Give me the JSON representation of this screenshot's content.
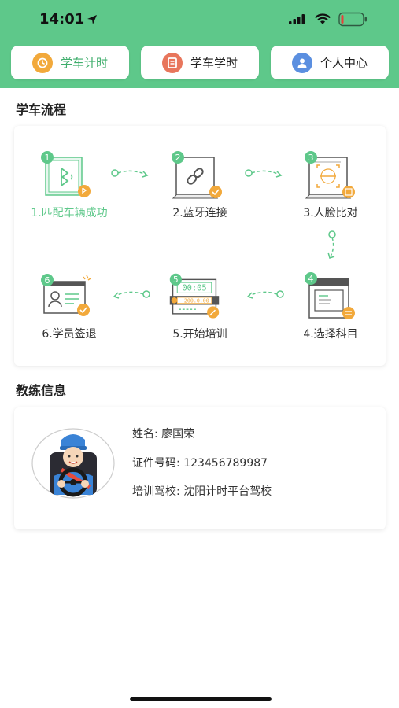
{
  "status_bar": {
    "time": "14:01",
    "icons": [
      "location-arrow-icon",
      "signal-icon",
      "wifi-icon",
      "battery-icon"
    ]
  },
  "tabs": [
    {
      "label": "学车计时",
      "icon": "clock-icon",
      "active": true
    },
    {
      "label": "学车学时",
      "icon": "document-icon",
      "active": false
    },
    {
      "label": "个人中心",
      "icon": "person-icon",
      "active": false
    }
  ],
  "flow": {
    "title": "学车流程",
    "steps": [
      {
        "num": "1",
        "label": "1.匹配车辆成功",
        "icon": "bluetooth-tablet-icon",
        "done": true
      },
      {
        "num": "2",
        "label": "2.蓝牙连接",
        "icon": "link-tablet-icon",
        "done": false
      },
      {
        "num": "3",
        "label": "3.人脸比对",
        "icon": "face-scan-icon",
        "done": false
      },
      {
        "num": "4",
        "label": "4.选择科目",
        "icon": "board-icon",
        "done": false
      },
      {
        "num": "5",
        "label": "5.开始培训",
        "icon": "timer-icon",
        "done": false
      },
      {
        "num": "6",
        "label": "6.学员签退",
        "icon": "id-card-icon",
        "done": false
      }
    ],
    "timer_display": "00:05",
    "amount_display": "200.0.00"
  },
  "coach": {
    "title": "教练信息",
    "name_label": "姓名:",
    "name_value": "廖国荣",
    "id_label": "证件号码:",
    "id_value": "123456789987",
    "school_label": "培训驾校:",
    "school_value": "沈阳计时平台驾校"
  },
  "colors": {
    "brand_green": "#5ec88a",
    "accent_orange": "#f2a93b",
    "tab_icon_red": "#e8765c",
    "tab_icon_blue": "#5b8fe0"
  }
}
